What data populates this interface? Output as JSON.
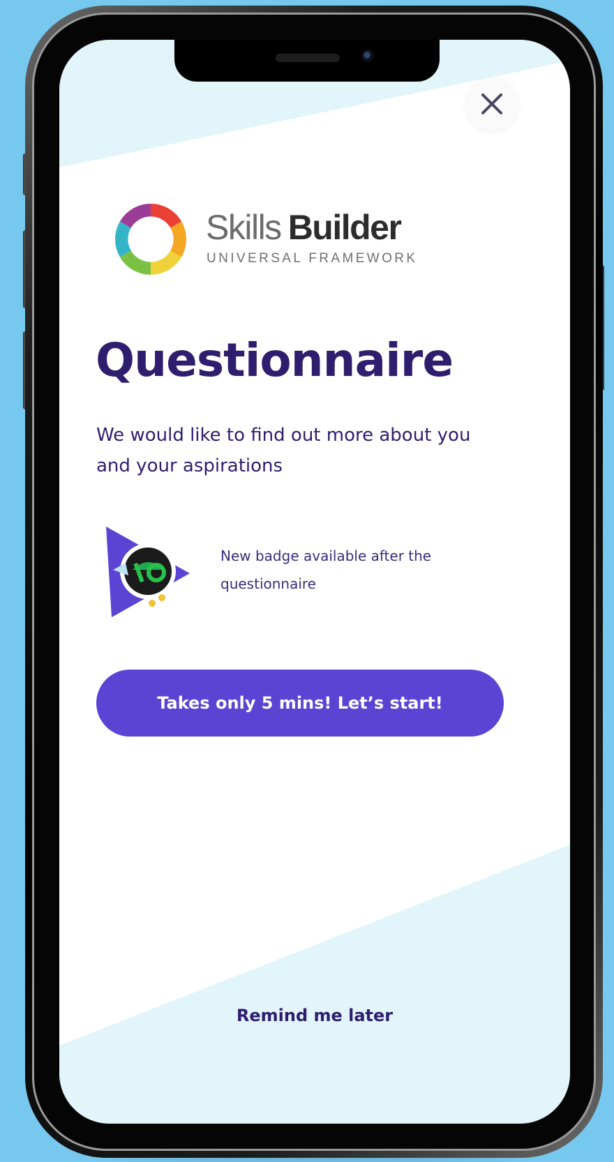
{
  "colors": {
    "background": "#77c8ef",
    "title": "#2f1d6e",
    "primary_button": "#5b44d4",
    "panel_tint": "#e1f5fa"
  },
  "icons": {
    "close": "close-icon",
    "logo": "skills-builder-ring-logo",
    "badge": "badge-icon"
  },
  "logo": {
    "word1": "Skills",
    "word2": "Builder",
    "subtitle": "UNIVERSAL FRAMEWORK"
  },
  "questionnaire": {
    "title": "Questionnaire",
    "intro": "We would like to find out more about you and your aspirations",
    "badge_note": "New badge available after the questionnaire",
    "start_button": "Takes only 5 mins! Let’s start!",
    "remind_link": "Remind me later"
  }
}
